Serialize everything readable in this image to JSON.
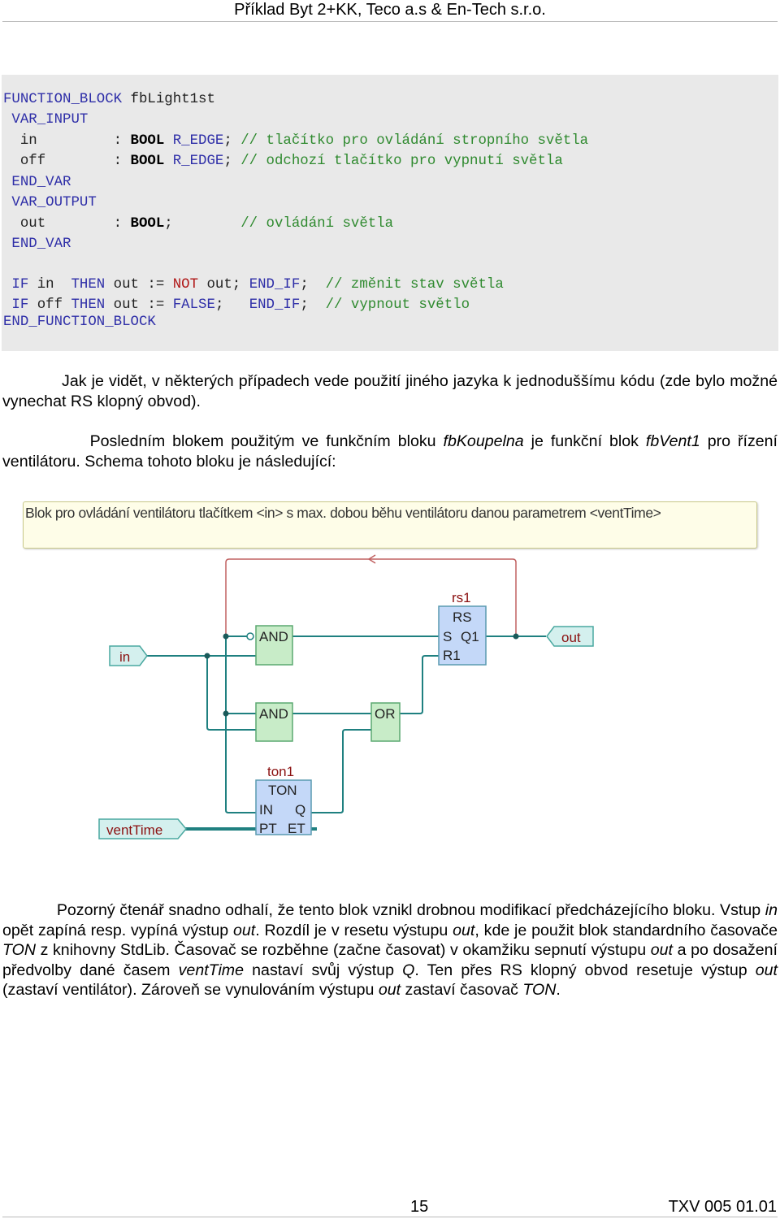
{
  "header": {
    "title": "Příklad Byt 2+KK, Teco a.s & En-Tech s.r.o."
  },
  "code": {
    "lines": [
      [
        {
          "t": "FUNCTION_BLOCK",
          "c": "kw"
        },
        {
          "t": " fbLight1st",
          "c": "tx"
        }
      ],
      [
        {
          "t": " VAR_INPUT",
          "c": "kw"
        }
      ],
      [
        {
          "t": "  in         : ",
          "c": "tx"
        },
        {
          "t": "BOOL",
          "c": "ty"
        },
        {
          "t": " R_EDGE",
          "c": "kw"
        },
        {
          "t": "; ",
          "c": "tx"
        },
        {
          "t": "// tlačítko pro ovládání stropního světla",
          "c": "cm"
        }
      ],
      [
        {
          "t": "  off        : ",
          "c": "tx"
        },
        {
          "t": "BOOL",
          "c": "ty"
        },
        {
          "t": " R_EDGE",
          "c": "kw"
        },
        {
          "t": "; ",
          "c": "tx"
        },
        {
          "t": "// odchozí tlačítko pro vypnutí světla",
          "c": "cm"
        }
      ],
      [
        {
          "t": " END_VAR",
          "c": "kw"
        }
      ],
      [
        {
          "t": " VAR_OUTPUT",
          "c": "kw"
        }
      ],
      [
        {
          "t": "  out        : ",
          "c": "tx"
        },
        {
          "t": "BOOL",
          "c": "ty"
        },
        {
          "t": ";        ",
          "c": "tx"
        },
        {
          "t": "// ovládání světla",
          "c": "cm"
        }
      ],
      [
        {
          "t": " END_VAR",
          "c": "kw"
        }
      ],
      [
        {
          "t": " IF",
          "c": "kw"
        },
        {
          "t": " in  ",
          "c": "tx"
        },
        {
          "t": "THEN",
          "c": "kw"
        },
        {
          "t": " out := ",
          "c": "tx"
        },
        {
          "t": "NOT",
          "c": "op"
        },
        {
          "t": " out; ",
          "c": "tx"
        },
        {
          "t": "END_IF",
          "c": "kw"
        },
        {
          "t": ";  ",
          "c": "tx"
        },
        {
          "t": "// změnit stav světla",
          "c": "cm"
        }
      ],
      [
        {
          "t": " IF",
          "c": "kw"
        },
        {
          "t": " off ",
          "c": "tx"
        },
        {
          "t": "THEN",
          "c": "kw"
        },
        {
          "t": " out := ",
          "c": "tx"
        },
        {
          "t": "FALSE",
          "c": "kw"
        },
        {
          "t": ";   ",
          "c": "tx"
        },
        {
          "t": "END_IF",
          "c": "kw"
        },
        {
          "t": ";  ",
          "c": "tx"
        },
        {
          "t": "// vypnout světlo",
          "c": "cm"
        }
      ],
      [
        {
          "t": "END_FUNCTION_BLOCK",
          "c": "kw"
        }
      ]
    ]
  },
  "paragraphs": [
    [
      {
        "t": "            Jak je vidět, v některých případech vede použití jiného jazyka k jednoduššímu kódu (zde bylo možné vynechat RS klopný obvod)."
      }
    ],
    [
      {
        "t": "            Posledním blokem použitým ve funkčním bloku "
      },
      {
        "t": "fbKoupelna",
        "i": true
      },
      {
        "t": " je funkční blok "
      },
      {
        "t": "fbVent1",
        "i": true
      },
      {
        "t": " pro řízení ventilátoru. Schema tohoto bloku je následující:"
      }
    ],
    [
      {
        "t": "            Pozorný čtenář snadno odhalí, že tento blok vznikl drobnou modifikací předcházejícího bloku. Vstup "
      },
      {
        "t": "in",
        "i": true
      },
      {
        "t": " opět zapíná resp. vypíná výstup "
      },
      {
        "t": "out",
        "i": true
      },
      {
        "t": ". Rozdíl je v resetu výstupu "
      },
      {
        "t": "out",
        "i": true
      },
      {
        "t": ", kde je použit blok standardního časovače "
      },
      {
        "t": "TON",
        "i": true
      },
      {
        "t": " z knihovny StdLib. Časovač se rozběhne (začne časovat) v okamžiku sepnutí výstupu "
      },
      {
        "t": "out",
        "i": true
      },
      {
        "t": " a po dosažení předvolby dané časem "
      },
      {
        "t": "ventTime",
        "i": true
      },
      {
        "t": " nastaví svůj výstup "
      },
      {
        "t": "Q",
        "i": true
      },
      {
        "t": ". Ten přes RS klopný obvod resetuje výstup "
      },
      {
        "t": "out",
        "i": true
      },
      {
        "t": " (zastaví ventilátor). Zároveň se vynulováním výstupu "
      },
      {
        "t": "out",
        "i": true
      },
      {
        "t": " zastaví časovač "
      },
      {
        "t": "TON",
        "i": true
      },
      {
        "t": "."
      }
    ]
  ],
  "diagram": {
    "comment": "Blok pro ovládání ventilátoru tlačítkem <in> s max. dobou běhu ventilátoru danou parametrem <ventTime>",
    "inputs": {
      "in": "in",
      "ventTime": "ventTime"
    },
    "output": "out",
    "and1": "AND",
    "and2": "AND",
    "or": "OR",
    "rs": {
      "instance": "rs1",
      "type": "RS",
      "s": "S",
      "q1": "Q1",
      "r1": "R1"
    },
    "ton": {
      "instance": "ton1",
      "type": "TON",
      "in": "IN",
      "q": "Q",
      "pt": "PT",
      "et": "ET"
    },
    "colors": {
      "wire": "#1f8080",
      "feedback": "#c06060",
      "gate": "#c8ecc8",
      "fb": "#c4d8f8",
      "io": "#d4f0ee",
      "label": "#8b1010"
    }
  },
  "footer": {
    "page": "15",
    "doc": "TXV 005 01.01"
  }
}
